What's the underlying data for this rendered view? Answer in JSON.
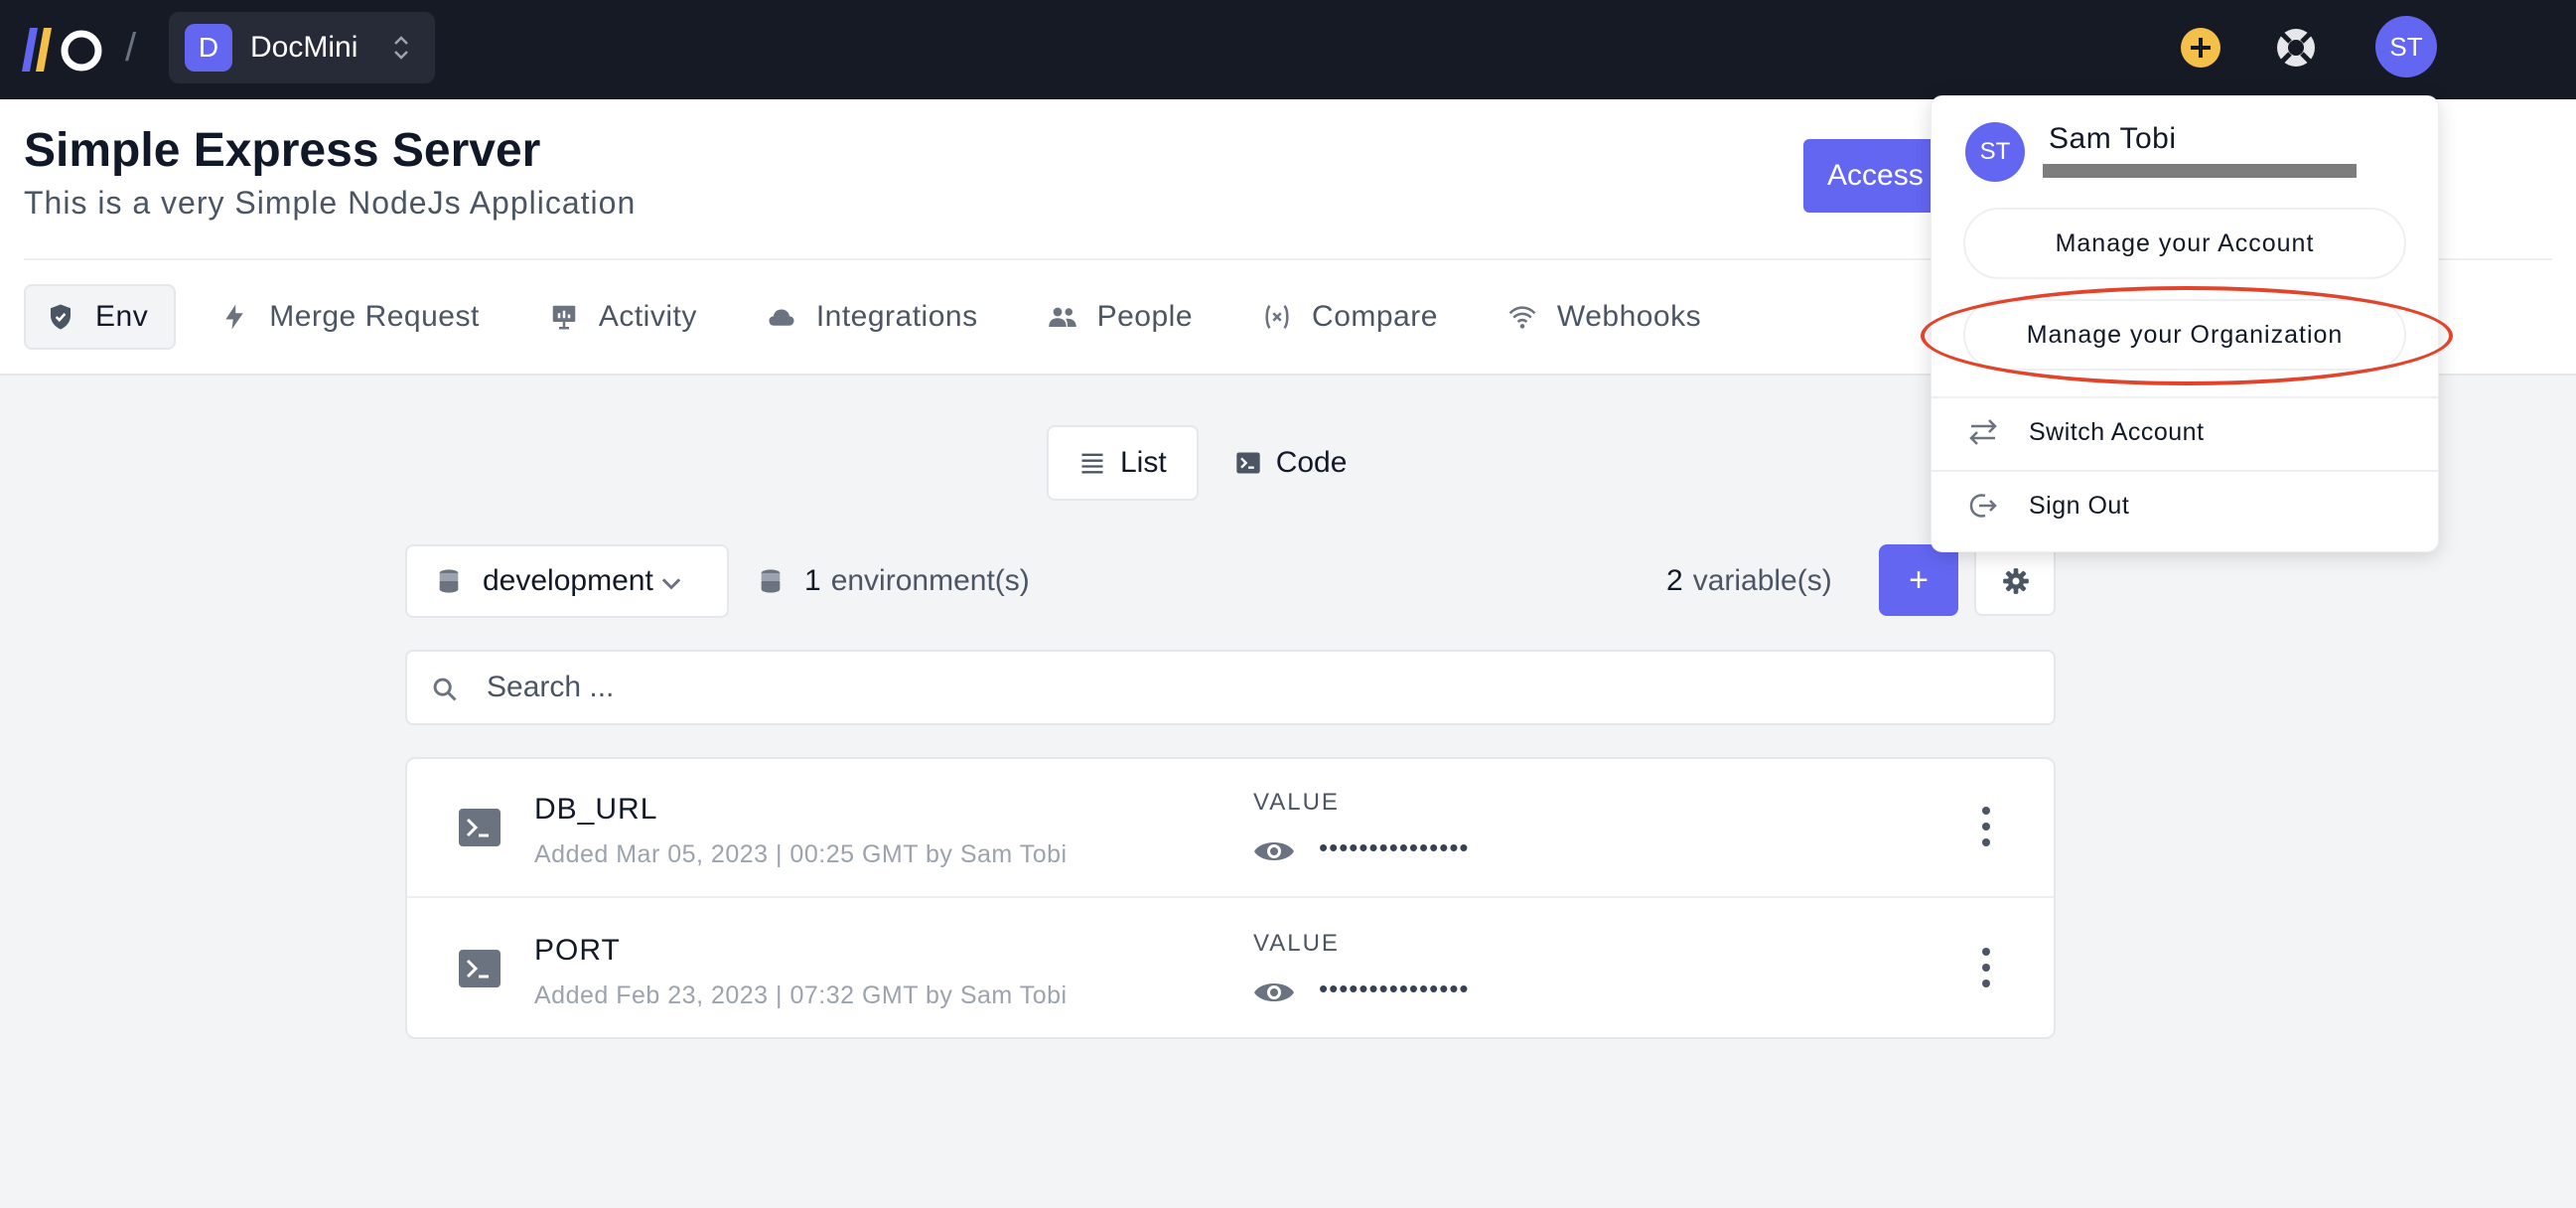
{
  "topbar": {
    "org_avatar_letter": "D",
    "org_name": "DocMini",
    "avatar_initials": "ST",
    "colors": {
      "bg": "#161a25",
      "accent": "#6366f1",
      "add_icon": "#f5c04a"
    },
    "icons": [
      "add-circle-icon",
      "help-lifebuoy-icon"
    ]
  },
  "project": {
    "title": "Simple Express Server",
    "subtitle": "This is a very Simple NodeJs Application",
    "access_button": "Access"
  },
  "tabs": [
    {
      "label": "Env",
      "icon": "shield-icon",
      "active": true
    },
    {
      "label": "Merge Request",
      "icon": "bolt-icon"
    },
    {
      "label": "Activity",
      "icon": "presentation-icon"
    },
    {
      "label": "Integrations",
      "icon": "cloud-icon"
    },
    {
      "label": "People",
      "icon": "users-icon"
    },
    {
      "label": "Compare",
      "icon": "variable-icon"
    },
    {
      "label": "Webhooks",
      "icon": "wifi-icon"
    }
  ],
  "view_toggle": {
    "list": "List",
    "code": "Code",
    "active": "list"
  },
  "env": {
    "selected": "development",
    "count": "1",
    "count_suffix": "environment(s)",
    "variable_count": "2",
    "variable_suffix": "variable(s)",
    "add_label": "+"
  },
  "search": {
    "placeholder": "Search ..."
  },
  "variables": [
    {
      "name": "DB_URL",
      "meta": "Added Mar 05, 2023 | 00:25 GMT by Sam Tobi",
      "value_label": "VALUE",
      "masked": "•••••••••••••••"
    },
    {
      "name": "PORT",
      "meta": "Added Feb 23, 2023 | 07:32 GMT by Sam Tobi",
      "value_label": "VALUE",
      "masked": "•••••••••••••••"
    }
  ],
  "dropdown": {
    "initials": "ST",
    "name": "Sam Tobi",
    "manage_account": "Manage your Account",
    "manage_org": "Manage your Organization",
    "switch_account": "Switch Account",
    "sign_out": "Sign Out",
    "highlight_color": "#e2432b"
  }
}
